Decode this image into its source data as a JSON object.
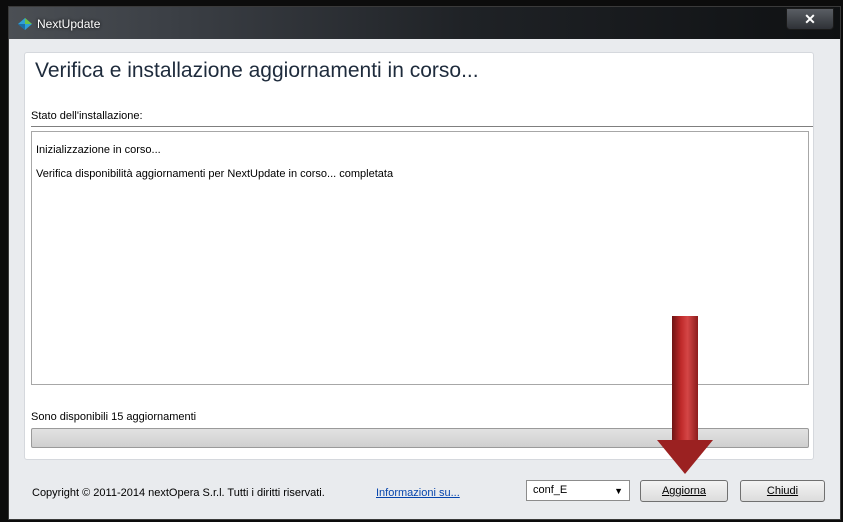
{
  "window": {
    "title": "NextUpdate",
    "close_glyph": "✕"
  },
  "main": {
    "heading": "Verifica e installazione aggiornamenti in corso...",
    "section_label": "Stato dell'installazione:",
    "log_lines": [
      "Inizializzazione in corso...",
      "Verifica disponibilità aggiornamenti per NextUpdate in corso... completata"
    ],
    "status_text": "Sono disponibili 15 aggiornamenti",
    "progress_fraction": 0.0
  },
  "footer": {
    "copyright": "Copyright © 2011-2014 nextOpera S.r.l. Tutti i diritti riservati.",
    "info_link": "Informazioni su...",
    "config_select": "conf_E",
    "update_button": "Aggiorna",
    "close_button": "Chiudi"
  },
  "colors": {
    "annotation_arrow": "#b02525",
    "link": "#0645ad"
  },
  "icons": {
    "app": "nextupdate-app-icon",
    "dropdown": "chevron-down-icon",
    "annotation": "down-arrow-annotation"
  }
}
